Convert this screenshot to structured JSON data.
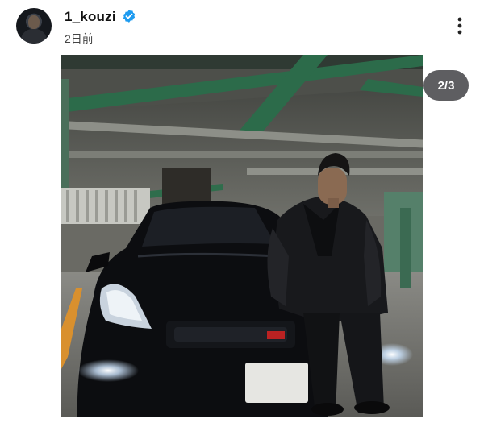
{
  "post": {
    "username": "1_kouzi",
    "time_ago": "2日前",
    "image_counter": "2/3"
  },
  "icons": {
    "verified": "verified-badge-icon",
    "more": "more-vertical-icon"
  },
  "colors": {
    "verified": "#1d9bf0",
    "counter_bg": "#505054"
  }
}
